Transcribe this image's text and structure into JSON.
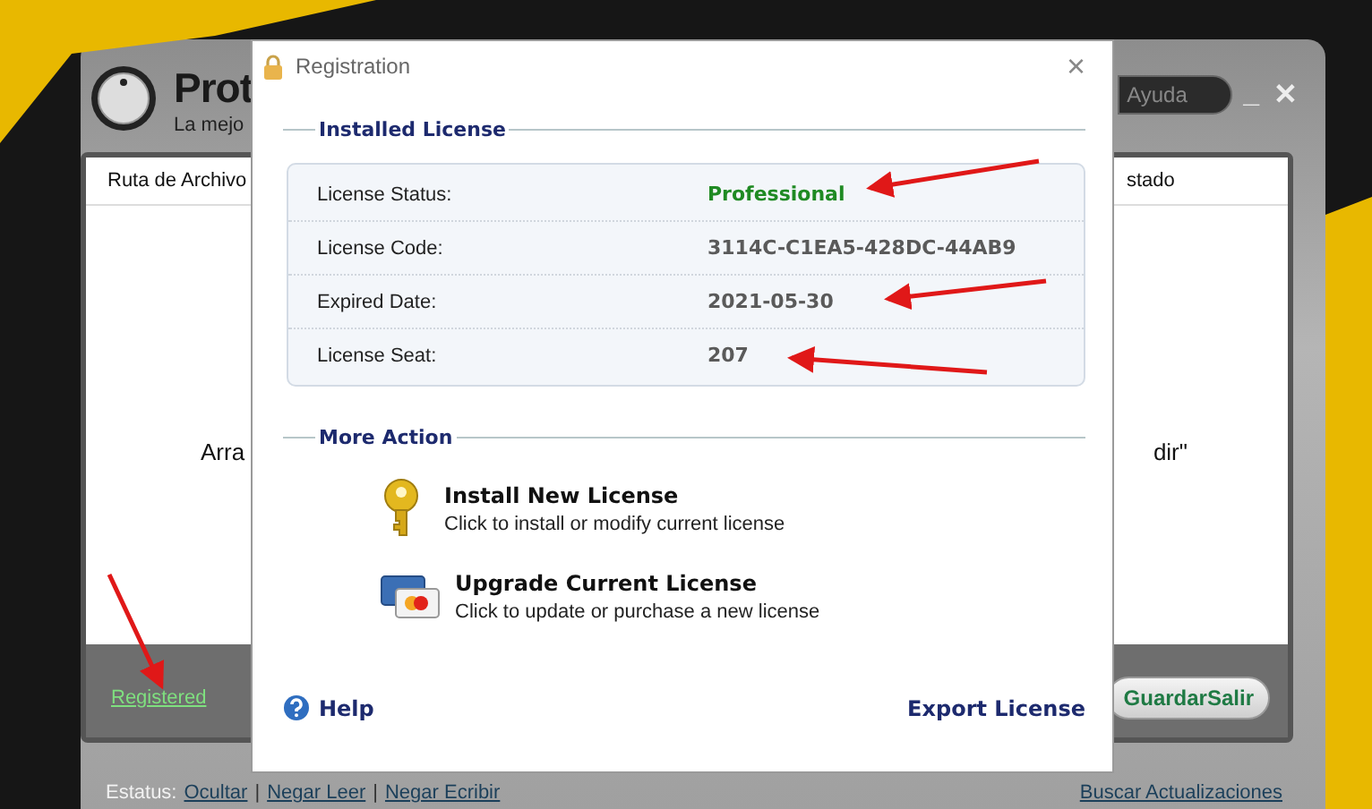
{
  "app": {
    "title": "Prot",
    "subtitle": "La mejo",
    "help_button": "Ayuda",
    "minimize": "_",
    "close": "✕",
    "columns": [
      "Ruta de Archivo",
      "stado"
    ],
    "empty_text_left": "Arra",
    "empty_text_right": "dir\"",
    "registered_link": "Registered",
    "save_exit_button": "GuardarSalir",
    "status_label": "Estatus:",
    "status_separator": "|",
    "status_links": [
      "Ocultar",
      "Negar Leer",
      "Negar Ecribir"
    ],
    "updates_link": "Buscar Actualizaciones"
  },
  "dialog": {
    "title": "Registration",
    "close": "×",
    "installed_section": "Installed License",
    "license_rows": [
      {
        "label": "License Status:",
        "value": "Professional",
        "color": "#1f8a23"
      },
      {
        "label": "License Code:",
        "value": "3114C-C1EA5-428DC-44AB9",
        "color": "#5a5a5a"
      },
      {
        "label": "Expired Date:",
        "value": "2021-05-30",
        "color": "#5a5a5a"
      },
      {
        "label": "License Seat:",
        "value": "207",
        "color": "#5a5a5a"
      }
    ],
    "more_section": "More Action",
    "actions": [
      {
        "kind": "key",
        "title": "Install New License",
        "description": "Click to install or modify current license"
      },
      {
        "kind": "card",
        "title": "Upgrade Current License",
        "description": "Click to update or purchase a new license"
      }
    ],
    "help": "Help",
    "export": "Export License"
  }
}
